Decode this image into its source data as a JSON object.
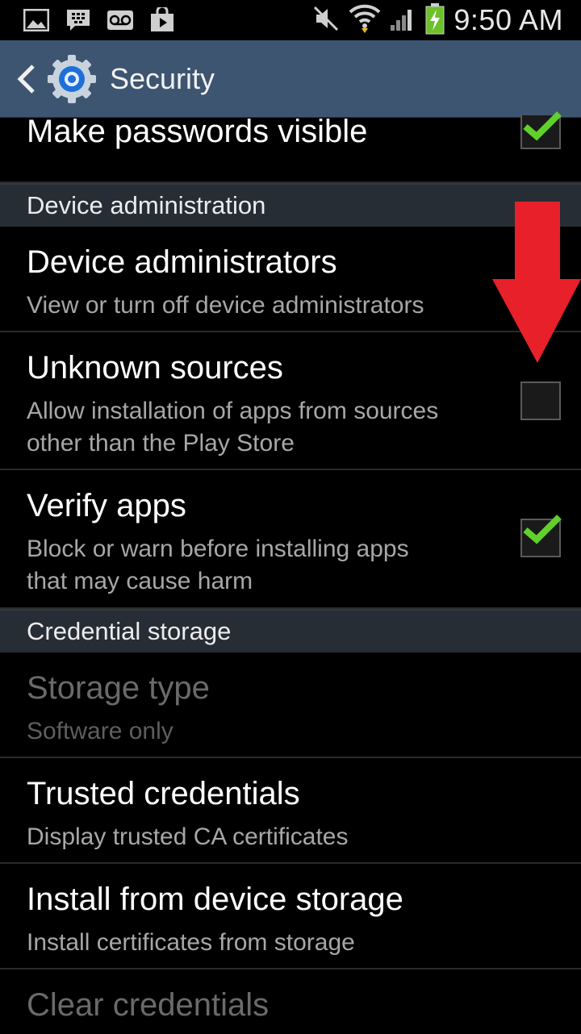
{
  "status_bar": {
    "time": "9:50 AM",
    "left_icons": [
      "gallery-icon",
      "bbm-icon",
      "voicemail-icon",
      "play-store-icon"
    ],
    "right_icons": [
      "mute-icon",
      "wifi-icon",
      "signal-icon",
      "battery-charging-icon"
    ]
  },
  "action_bar": {
    "title": "Security"
  },
  "list": {
    "make_passwords_visible": {
      "title": "Make passwords visible",
      "checked": true
    },
    "section_device_admin": "Device administration",
    "device_administrators": {
      "title": "Device administrators",
      "summary": "View or turn off device administrators"
    },
    "unknown_sources": {
      "title": "Unknown sources",
      "summary_line1": "Allow installation of apps from sources",
      "summary_line2": "other than the Play Store",
      "checked": false
    },
    "verify_apps": {
      "title": "Verify apps",
      "summary_line1": "Block or warn before installing apps",
      "summary_line2": "that may cause harm",
      "checked": true
    },
    "section_credential_storage": "Credential storage",
    "storage_type": {
      "title": "Storage type",
      "summary": "Software only",
      "enabled": false
    },
    "trusted_credentials": {
      "title": "Trusted credentials",
      "summary": "Display trusted CA certificates"
    },
    "install_from_storage": {
      "title": "Install from device storage",
      "summary": "Install certificates from storage"
    },
    "clear_credentials": {
      "title": "Clear credentials",
      "enabled": false
    }
  },
  "colors": {
    "action_bar": "#3d5571",
    "section_header": "#262d34",
    "check_green": "#5fd12a",
    "annotation_red": "#e8202a"
  }
}
